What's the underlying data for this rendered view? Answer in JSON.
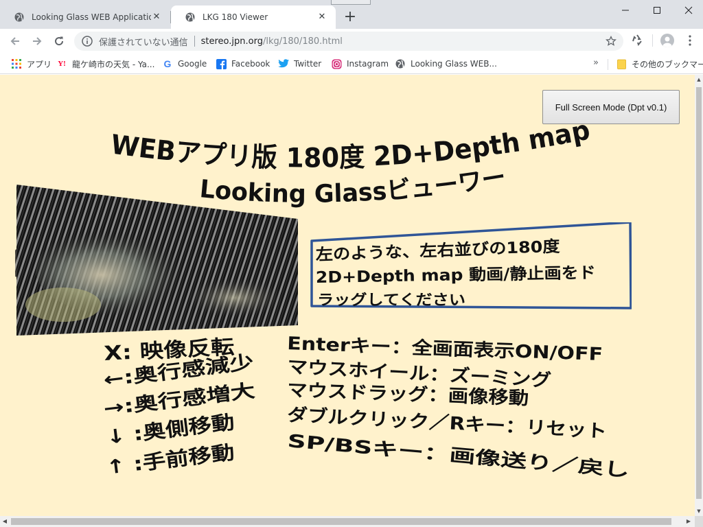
{
  "colors": {
    "page_background": "#fff2cc",
    "tab_strip": "#dee1e6",
    "box_border": "#2f5597",
    "text": "#111111"
  },
  "tabs": [
    {
      "title": "Looking Glass WEB Applications",
      "icon": "globe-icon",
      "active": false
    },
    {
      "title": "LKG 180 Viewer",
      "icon": "globe-icon",
      "active": true
    }
  ],
  "address_bar": {
    "security_label": "保護されていない通信",
    "host": "stereo.jpn.org",
    "path": "/lkg/180/180.html"
  },
  "bookmarks": {
    "items": [
      {
        "label": "アプリ",
        "icon": "apps-grid-icon"
      },
      {
        "label": "龍ケ崎市の天気 - Ya...",
        "icon": "yahoo-icon"
      },
      {
        "label": "Google",
        "icon": "google-icon"
      },
      {
        "label": "Facebook",
        "icon": "facebook-icon"
      },
      {
        "label": "Twitter",
        "icon": "twitter-icon"
      },
      {
        "label": "Instagram",
        "icon": "instagram-icon"
      },
      {
        "label": "Looking Glass WEB...",
        "icon": "globe-icon"
      }
    ],
    "more": "»",
    "other_bookmarks": "その他のブックマーク"
  },
  "page": {
    "fullscreen_button": "Full Screen Mode (Dpt v0.1)",
    "title_line1": "WEBアプリ版 180度 2D+Depth map",
    "title_line2": "Looking Glassビューワー",
    "instruction_lines": [
      "左のような、左右並びの180度",
      "2D+Depth map 動画/静止画をド",
      "ラッグしてください"
    ],
    "key_controls_left": [
      "X: 映像反転",
      "←:奥行感減少",
      "→:奥行感増大",
      "↓ :奥側移動",
      "↑ :手前移動"
    ],
    "key_controls_right": [
      "Enterキー：全画面表示ON/OFF",
      "マウスホイール：ズーミング",
      "マウスドラッグ：画像移動",
      "ダブルクリック／Rキー：リセット",
      "SP/BSキー：画像送り／戻し"
    ]
  }
}
